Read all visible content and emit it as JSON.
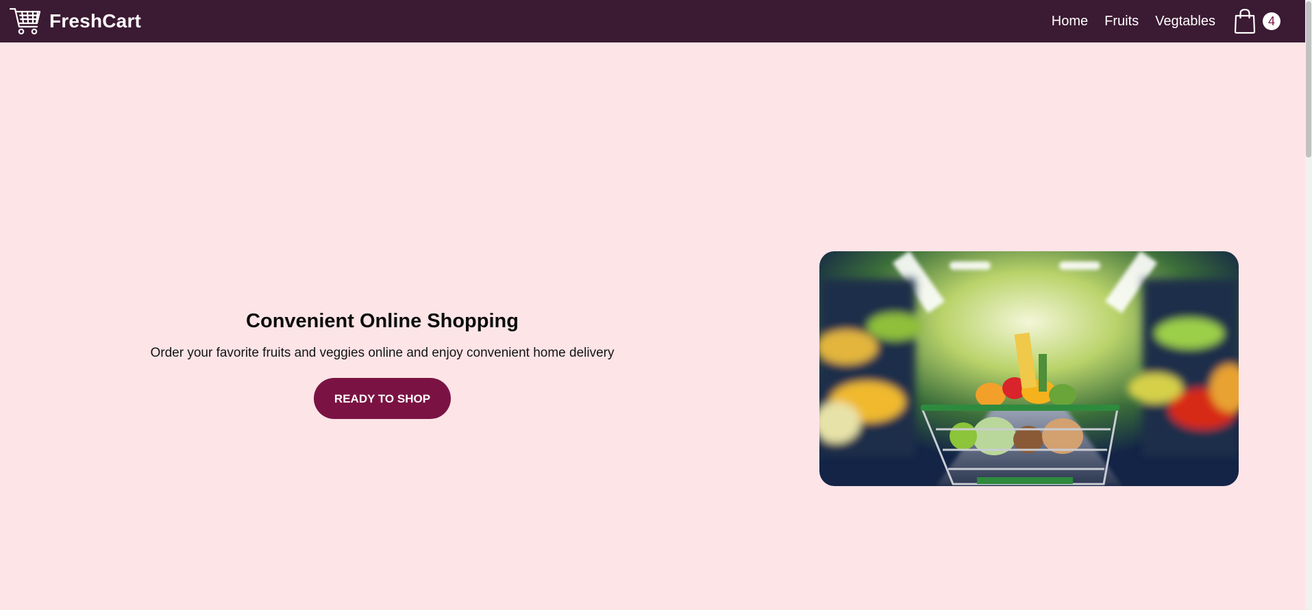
{
  "navbar": {
    "brand_name": "FreshCart",
    "brand_icon": "shopping-cart-icon",
    "links": [
      "Home",
      "Fruits",
      "Vegtables"
    ],
    "cart_icon": "shopping-bag-icon",
    "cart_count": "4",
    "background_color": "#3b1a33"
  },
  "hero": {
    "title": "Convenient Online Shopping",
    "subtitle": "Order your favorite fruits and veggies online and enjoy convenient home delivery",
    "button_label": "READY TO SHOP",
    "button_color": "#7a1343",
    "image": "grocery-cart-aisle-photo"
  },
  "page": {
    "background_color": "#fde4e7"
  }
}
